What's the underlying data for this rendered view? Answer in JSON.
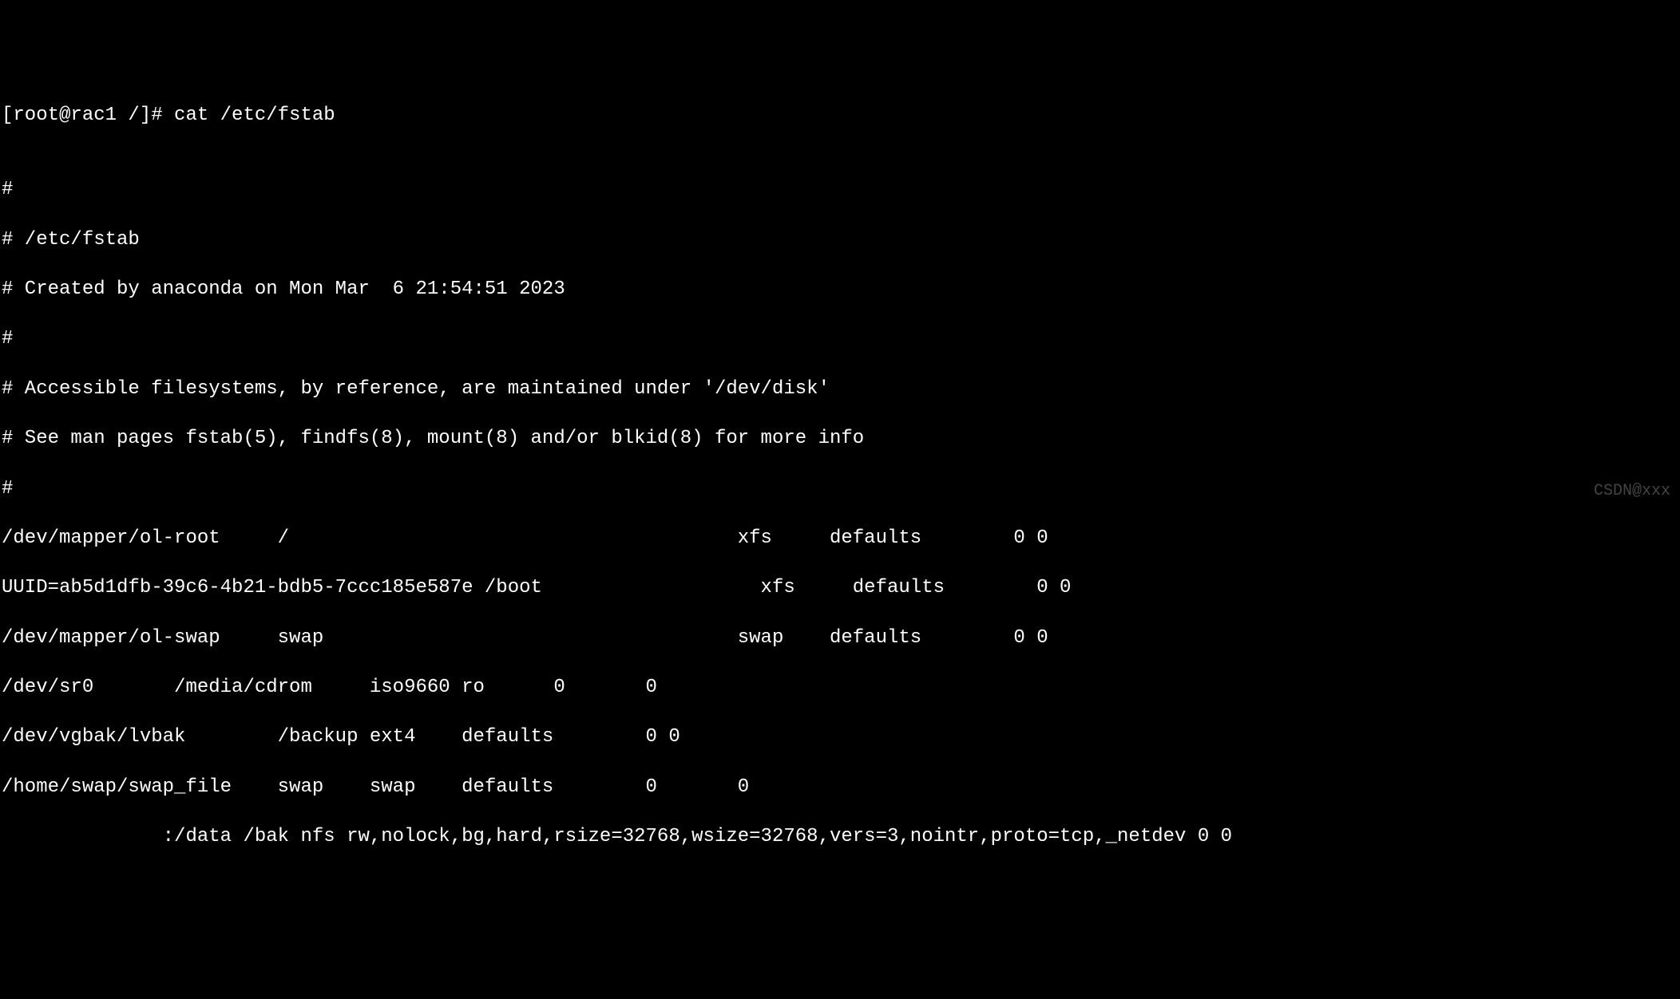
{
  "terminal": {
    "prompt_line": "[root@rac1 /]# cat /etc/fstab",
    "blank": "",
    "comment1": "#",
    "comment2": "# /etc/fstab",
    "comment3": "# Created by anaconda on Mon Mar  6 21:54:51 2023",
    "comment4": "#",
    "comment5": "# Accessible filesystems, by reference, are maintained under '/dev/disk'",
    "comment6": "# See man pages fstab(5), findfs(8), mount(8) and/or blkid(8) for more info",
    "comment7": "#",
    "entry1": "/dev/mapper/ol-root     /                                       xfs     defaults        0 0",
    "entry2": "UUID=ab5d1dfb-39c6-4b21-bdb5-7ccc185e587e /boot                   xfs     defaults        0 0",
    "entry3": "/dev/mapper/ol-swap     swap                                    swap    defaults        0 0",
    "entry4": "/dev/sr0       /media/cdrom     iso9660 ro      0       0",
    "entry5": "/dev/vgbak/lvbak        /backup ext4    defaults        0 0",
    "entry6": "/home/swap/swap_file    swap    swap    defaults        0       0",
    "entry7": "              :/data /bak nfs rw,nolock,bg,hard,rsize=32768,wsize=32768,vers=3,nointr,proto=tcp,_netdev 0 0"
  },
  "watermark": "CSDN@xxx"
}
